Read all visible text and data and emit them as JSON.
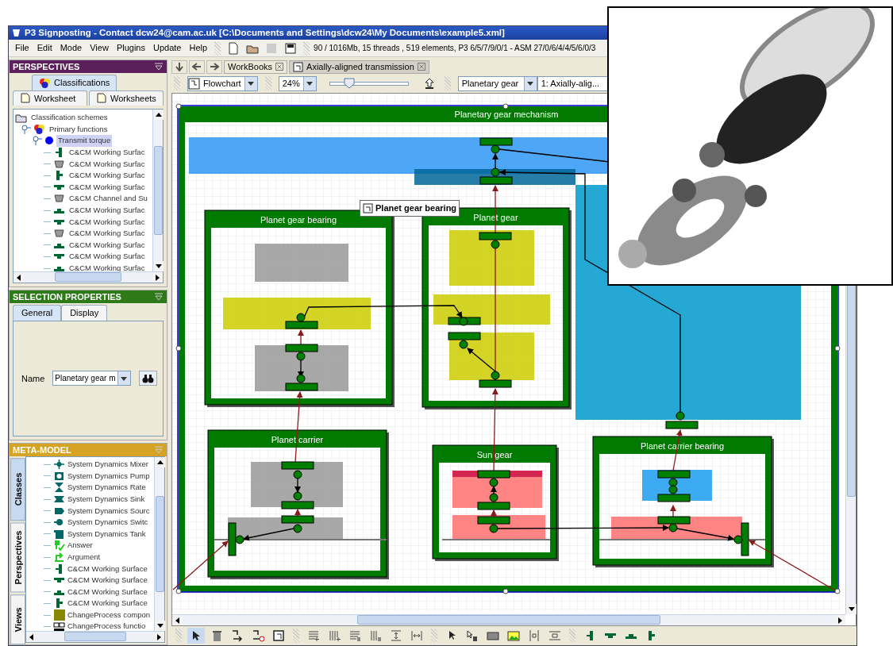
{
  "window": {
    "title": "P3 Signposting - Contact dcw24@cam.ac.uk [C:\\Documents and Settings\\dcw24\\My Documents\\example5.xml]"
  },
  "menu": [
    "File",
    "Edit",
    "Mode",
    "View",
    "Plugins",
    "Update",
    "Help"
  ],
  "status_text": "90 / 1016Mb, 15 threads , 519 elements, P3 6/5/7/9/0/1 - ASM 27/0/6/4/4/5/6/0/3",
  "perspectives": {
    "title": "PERSPECTIVES",
    "tabs": [
      {
        "label": "Classifications",
        "selected": true
      },
      {
        "label": "Worksheet",
        "selected": false
      },
      {
        "label": "Worksheets",
        "selected": false
      }
    ],
    "tree": [
      {
        "label": "Classification schemes",
        "kind": "folder",
        "selected": false,
        "children": [
          {
            "label": "Primary functions",
            "kind": "scheme",
            "selected": false,
            "children": [
              {
                "label": "Transmit torque",
                "kind": "function",
                "selected": true,
                "children": [
                  {
                    "label": "C&CM Working Surfac",
                    "kind": "ws-left",
                    "selected": false
                  },
                  {
                    "label": "C&CM Working Surfac",
                    "kind": "channel",
                    "selected": false
                  },
                  {
                    "label": "C&CM Working Surfac",
                    "kind": "ws-right",
                    "selected": false
                  },
                  {
                    "label": "C&CM Working Surfac",
                    "kind": "ws-bottom",
                    "selected": false
                  },
                  {
                    "label": "C&CM Channel and Su",
                    "kind": "channel",
                    "selected": false
                  },
                  {
                    "label": "C&CM Working Surfac",
                    "kind": "ws-top",
                    "selected": false
                  },
                  {
                    "label": "C&CM Working Surfac",
                    "kind": "ws-bottom",
                    "selected": false
                  },
                  {
                    "label": "C&CM Working Surfac",
                    "kind": "channel",
                    "selected": false
                  },
                  {
                    "label": "C&CM Working Surfac",
                    "kind": "ws-top",
                    "selected": false
                  },
                  {
                    "label": "C&CM Working Surfac",
                    "kind": "ws-bottom",
                    "selected": false
                  },
                  {
                    "label": "C&CM Working Surfac",
                    "kind": "ws-top",
                    "selected": false
                  }
                ]
              }
            ]
          }
        ]
      }
    ]
  },
  "selection_properties": {
    "title": "SELECTION PROPERTIES",
    "tabs": [
      {
        "label": "General",
        "selected": true
      },
      {
        "label": "Display",
        "selected": false
      }
    ],
    "fields": [
      {
        "label": "Name",
        "value": "Planetary gear m"
      }
    ]
  },
  "meta_model": {
    "title": "META-MODEL",
    "side_tabs": [
      {
        "label": "Classes",
        "selected": true
      },
      {
        "label": "Perspectives",
        "selected": false
      },
      {
        "label": "Views",
        "selected": false
      }
    ],
    "items": [
      {
        "label": "System Dynamics Mixer",
        "kind": "sd-mixer",
        "selected": false
      },
      {
        "label": "System Dynamics Pump",
        "kind": "sd-pump",
        "selected": false
      },
      {
        "label": "System Dynamics Rate",
        "kind": "sd-rate",
        "selected": false
      },
      {
        "label": "System Dynamics Sink",
        "kind": "sd-sink",
        "selected": false
      },
      {
        "label": "System Dynamics Sourc",
        "kind": "sd-source",
        "selected": false
      },
      {
        "label": "System Dynamics Switc",
        "kind": "sd-switch",
        "selected": false
      },
      {
        "label": "System Dynamics Tank",
        "kind": "sd-tank",
        "selected": false
      },
      {
        "label": "Answer",
        "kind": "answer",
        "selected": false
      },
      {
        "label": "Argument",
        "kind": "argument",
        "selected": false
      },
      {
        "label": "C&CM Working Surface",
        "kind": "ws-left",
        "selected": false
      },
      {
        "label": "C&CM Working Surface",
        "kind": "ws-bottom",
        "selected": false
      },
      {
        "label": "C&CM Working Surface",
        "kind": "ws-top",
        "selected": false
      },
      {
        "label": "C&CM Working Surface",
        "kind": "ws-right",
        "selected": false
      },
      {
        "label": "ChangeProcess compon",
        "kind": "cp-component",
        "selected": false
      },
      {
        "label": "ChangeProcess functio",
        "kind": "cp-function",
        "selected": false
      }
    ]
  },
  "document_tabs": [
    {
      "label": "WorkBooks",
      "selected": false
    },
    {
      "label": "Axially-aligned transmission",
      "selected": true
    }
  ],
  "toolbar": {
    "view_mode": "Flowchart",
    "zoom": "24%",
    "zoom_slider": {
      "level": 0.25
    },
    "workbook": "Planetary gear",
    "sheet": "1: Axially-alig..."
  },
  "diagram": {
    "title": "Planetary gear mechanism",
    "containers": [
      {
        "title": "Planet gear bearing"
      },
      {
        "title": "Planet gear"
      },
      {
        "title": "Planet carrier"
      },
      {
        "title": "Sun gear"
      },
      {
        "title": "Planet carrier bearing"
      }
    ],
    "tooltip": "Planet gear bearing"
  }
}
